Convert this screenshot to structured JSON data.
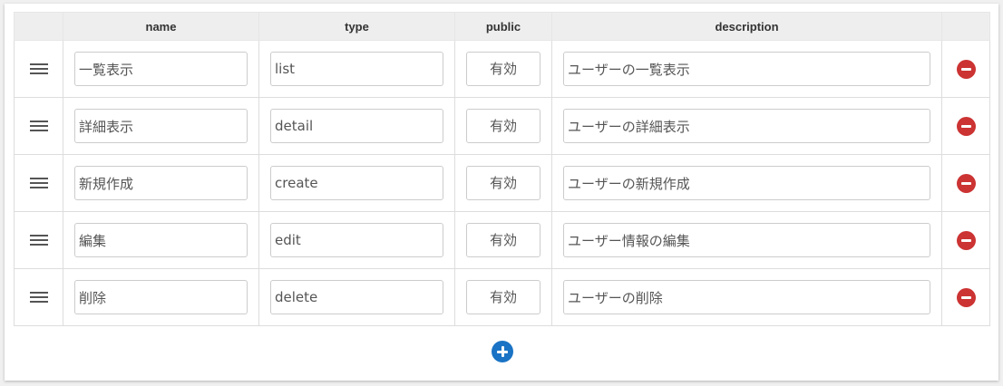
{
  "table": {
    "headers": {
      "handle": "",
      "name": "name",
      "type": "type",
      "public": "public",
      "description": "description",
      "actions": ""
    },
    "rows": [
      {
        "name": "一覧表示",
        "type": "list",
        "public": "有効",
        "description": "ユーザーの一覧表示"
      },
      {
        "name": "詳細表示",
        "type": "detail",
        "public": "有効",
        "description": "ユーザーの詳細表示"
      },
      {
        "name": "新規作成",
        "type": "create",
        "public": "有効",
        "description": "ユーザーの新規作成"
      },
      {
        "name": "編集",
        "type": "edit",
        "public": "有効",
        "description": "ユーザー情報の編集"
      },
      {
        "name": "削除",
        "type": "delete",
        "public": "有効",
        "description": "ユーザーの削除"
      }
    ]
  },
  "icons": {
    "row_handle": "drag-handle-icon",
    "remove": "minus-circle-icon",
    "add": "plus-circle-icon"
  },
  "colors": {
    "remove": "#cc3333",
    "add": "#1a73c4",
    "header_bg": "#eeeeee"
  }
}
